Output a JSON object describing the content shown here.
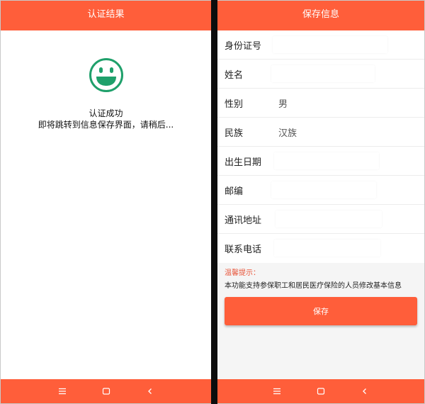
{
  "left_screen": {
    "title": "认证结果",
    "success": "认证成功",
    "redirect": "即将跳转到信息保存界面，请稍后..."
  },
  "right_screen": {
    "title": "保存信息",
    "fields": [
      {
        "label": "身份证号",
        "value": ""
      },
      {
        "label": "姓名",
        "value": ""
      },
      {
        "label": "性别",
        "value": "男"
      },
      {
        "label": "民族",
        "value": "汉族"
      },
      {
        "label": "出生日期",
        "value": ""
      },
      {
        "label": "邮编",
        "value": ""
      },
      {
        "label": "通讯地址",
        "value": ""
      },
      {
        "label": "联系电话",
        "value": ""
      }
    ],
    "tip_title": "温馨提示：",
    "tip_text": "本功能支持参保职工和居民医疗保险的人员修改基本信息",
    "save_label": "保存"
  },
  "colors": {
    "accent": "#ff5e3a",
    "smiley": "#1fa06b",
    "tip": "#e8553a"
  },
  "nav_icons": [
    "menu-icon",
    "home-icon",
    "back-icon"
  ]
}
